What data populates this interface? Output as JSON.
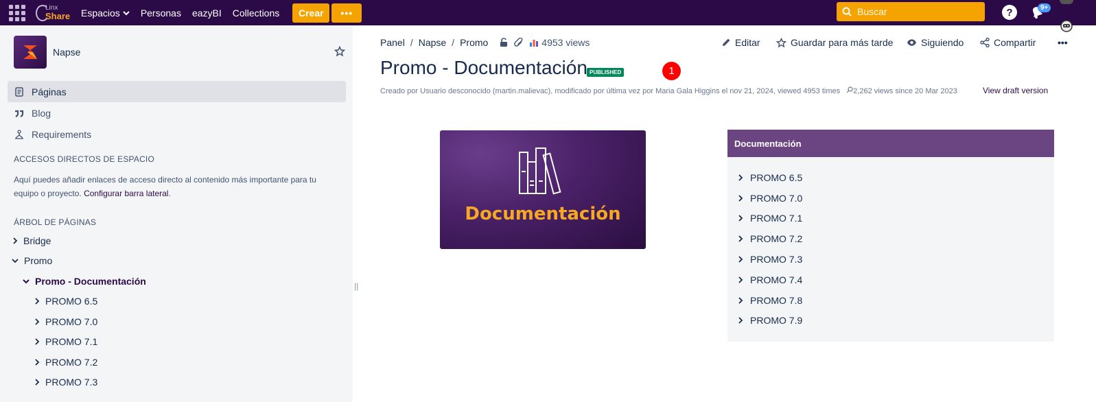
{
  "topbar": {
    "logo_line1": "Linx",
    "logo_line2": "Share",
    "nav": [
      "Espacios",
      "Personas",
      "eazyBI",
      "Collections"
    ],
    "create_label": "Crear",
    "more_label": "•••",
    "search_placeholder": "Buscar",
    "help_label": "?",
    "notif_badge": "9+"
  },
  "sidebar": {
    "space_name": "Napse",
    "nav": [
      {
        "label": "Páginas",
        "icon": "pages-icon",
        "active": true
      },
      {
        "label": "Blog",
        "icon": "quote-icon",
        "active": false
      },
      {
        "label": "Requirements",
        "icon": "requirements-icon",
        "active": false
      }
    ],
    "shortcuts_label": "ACCESOS DIRECTOS DE ESPACIO",
    "shortcuts_text": "Aquí puedes añadir enlaces de acceso directo al contenido más importante para tu equipo o proyecto. ",
    "shortcuts_link": "Configurar barra lateral",
    "shortcuts_end": ".",
    "tree_label": "ÁRBOL DE PÁGINAS",
    "tree": [
      {
        "label": "Bridge",
        "level": 0,
        "expanded": false,
        "current": false
      },
      {
        "label": "Promo",
        "level": 0,
        "expanded": true,
        "current": false
      },
      {
        "label": "Promo - Documentación",
        "level": 1,
        "expanded": true,
        "current": true
      },
      {
        "label": "PROMO 6.5",
        "level": 2,
        "expanded": false,
        "current": false
      },
      {
        "label": "PROMO 7.0",
        "level": 2,
        "expanded": false,
        "current": false
      },
      {
        "label": "PROMO 7.1",
        "level": 2,
        "expanded": false,
        "current": false
      },
      {
        "label": "PROMO 7.2",
        "level": 2,
        "expanded": false,
        "current": false
      },
      {
        "label": "PROMO 7.3",
        "level": 2,
        "expanded": false,
        "current": false
      }
    ]
  },
  "breadcrumb": {
    "items": [
      "Panel",
      "Napse",
      "Promo"
    ],
    "views": "4953 views"
  },
  "actions": {
    "edit": "Editar",
    "save_later": "Guardar para más tarde",
    "following": "Siguiendo",
    "share": "Compartir",
    "more": "•••"
  },
  "page": {
    "title": "Promo - Documentación",
    "status": "PUBLISHED",
    "marker": "1",
    "byline": "Creado por Usuario desconocido (martin.malievac), modificado por última vez por Maria Gala Higgins el nov 21, 2024, viewed 4953 times",
    "views_since": "2,262 views since 20 Mar 2023",
    "draft_link": "View draft version",
    "hero_text": "Documentación"
  },
  "doc_panel": {
    "title": "Documentación",
    "items": [
      "PROMO 6.5",
      "PROMO 7.0",
      "PROMO 7.1",
      "PROMO 7.2",
      "PROMO 7.3",
      "PROMO 7.4",
      "PROMO 7.8",
      "PROMO 7.9"
    ]
  },
  "colors": {
    "topbar": "#2C0A47",
    "accent": "#F5A300",
    "published": "#00875A",
    "panel_header": "#6B4582"
  }
}
